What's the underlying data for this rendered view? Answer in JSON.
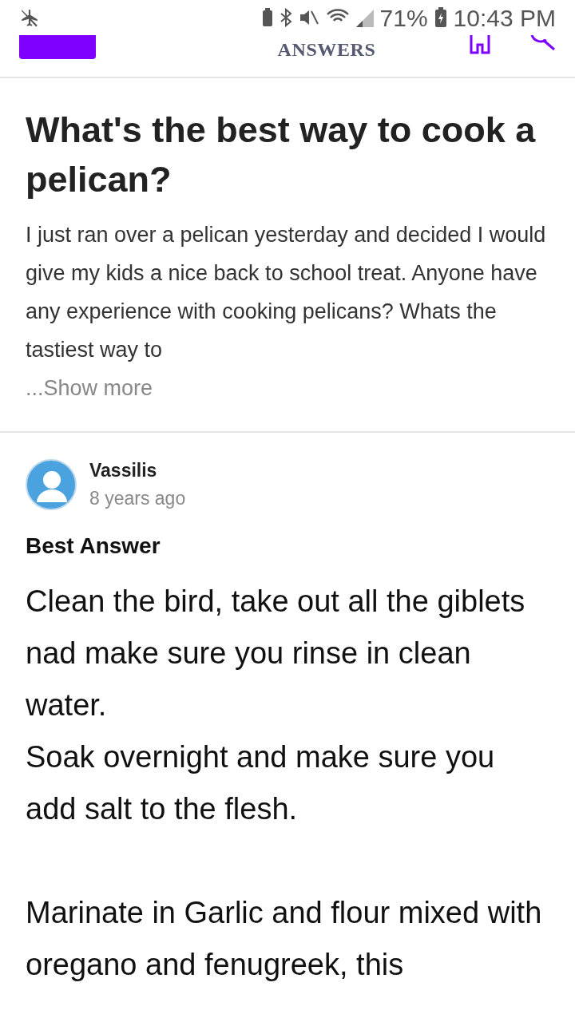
{
  "status_bar": {
    "battery": "71%",
    "time": "10:43 PM"
  },
  "header": {
    "logo_subtitle": "ANSWERS"
  },
  "question": {
    "title": "What's the best way to cook a pelican?",
    "body": "I just ran over a pelican yesterday and decided I would give my kids a nice back to school treat. Anyone have any experience with cooking pelicans? Whats the tastiest way to",
    "show_more": "...Show more"
  },
  "answer": {
    "author": "Vassilis",
    "time": "8 years ago",
    "label": "Best Answer",
    "paragraphs": [
      {
        "lines": [
          "Clean the bird, take out all the giblets nad make sure you rinse in clean water.",
          "Soak overnight and make sure you add salt to the flesh."
        ]
      },
      {
        "lines": [
          "Marinate in Garlic and flour mixed with oregano and fenugreek, this"
        ]
      }
    ]
  }
}
